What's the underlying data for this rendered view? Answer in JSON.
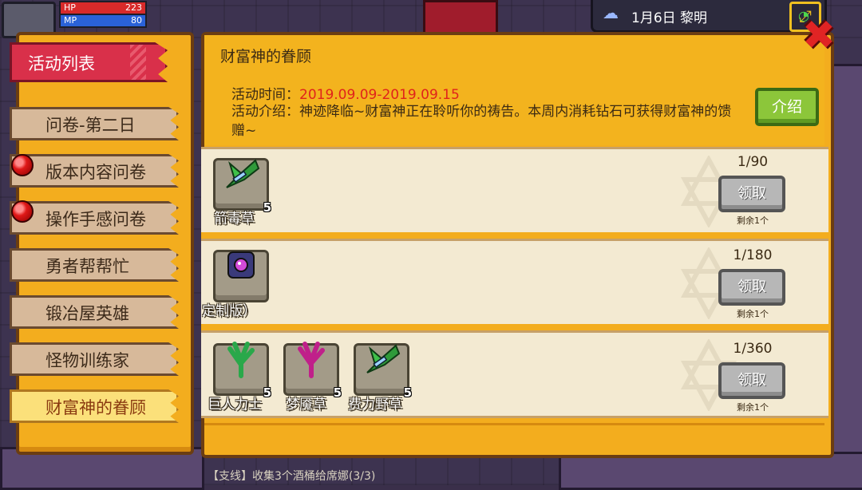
{
  "hud": {
    "hp_label": "HP",
    "hp_value": "223",
    "mp_label": "MP",
    "mp_value": "80",
    "date": "1月6日  黎明"
  },
  "sidebar": {
    "title": "活动列表",
    "tabs": [
      {
        "label": "问卷-第二日",
        "badge": false,
        "active": false
      },
      {
        "label": "版本内容问卷",
        "badge": true,
        "active": false
      },
      {
        "label": "操作手感问卷",
        "badge": true,
        "active": false
      },
      {
        "label": "勇者帮帮忙",
        "badge": false,
        "active": false
      },
      {
        "label": "锻冶屋英雄",
        "badge": false,
        "active": false
      },
      {
        "label": "怪物训练家",
        "badge": false,
        "active": false
      },
      {
        "label": "财富神的眷顾",
        "badge": false,
        "active": true
      }
    ]
  },
  "event": {
    "title": "财富神的眷顾",
    "time_label": "活动时间：",
    "time_value": "2019.09.09-2019.09.15",
    "desc": "活动介绍：神迹降临~财富神正在聆听你的祷告。本周内消耗钻石可获得财富神的馈赠~",
    "intro_button": "介绍"
  },
  "rewards": [
    {
      "progress": "1/90",
      "claim": "领取",
      "remain": "剩余1个",
      "items": [
        {
          "name": "箭毒草",
          "qty": "5",
          "icon": "poison-herb-icon"
        }
      ]
    },
    {
      "progress": "1/180",
      "claim": "领取",
      "remain": "剩余1个",
      "items": [
        {
          "name": "定制版）",
          "qty": "",
          "icon": "custom-gem-box-icon"
        }
      ]
    },
    {
      "progress": "1/360",
      "claim": "领取",
      "remain": "剩余1个",
      "items": [
        {
          "name": "巨人力士",
          "qty": "5",
          "icon": "giant-herb-icon"
        },
        {
          "name": "梦魇草",
          "qty": "5",
          "icon": "nightmare-herb-icon"
        },
        {
          "name": "费力野草",
          "qty": "5",
          "icon": "wild-herb-icon"
        }
      ]
    }
  ],
  "quest": "【支线】收集3个酒桶给席娜(3/3)",
  "colors": {
    "panel": "#f3ad1e",
    "highlight_red": "#e0231b",
    "intro_green": "#8cc63a",
    "claim_gray": "#b7b7b7"
  }
}
